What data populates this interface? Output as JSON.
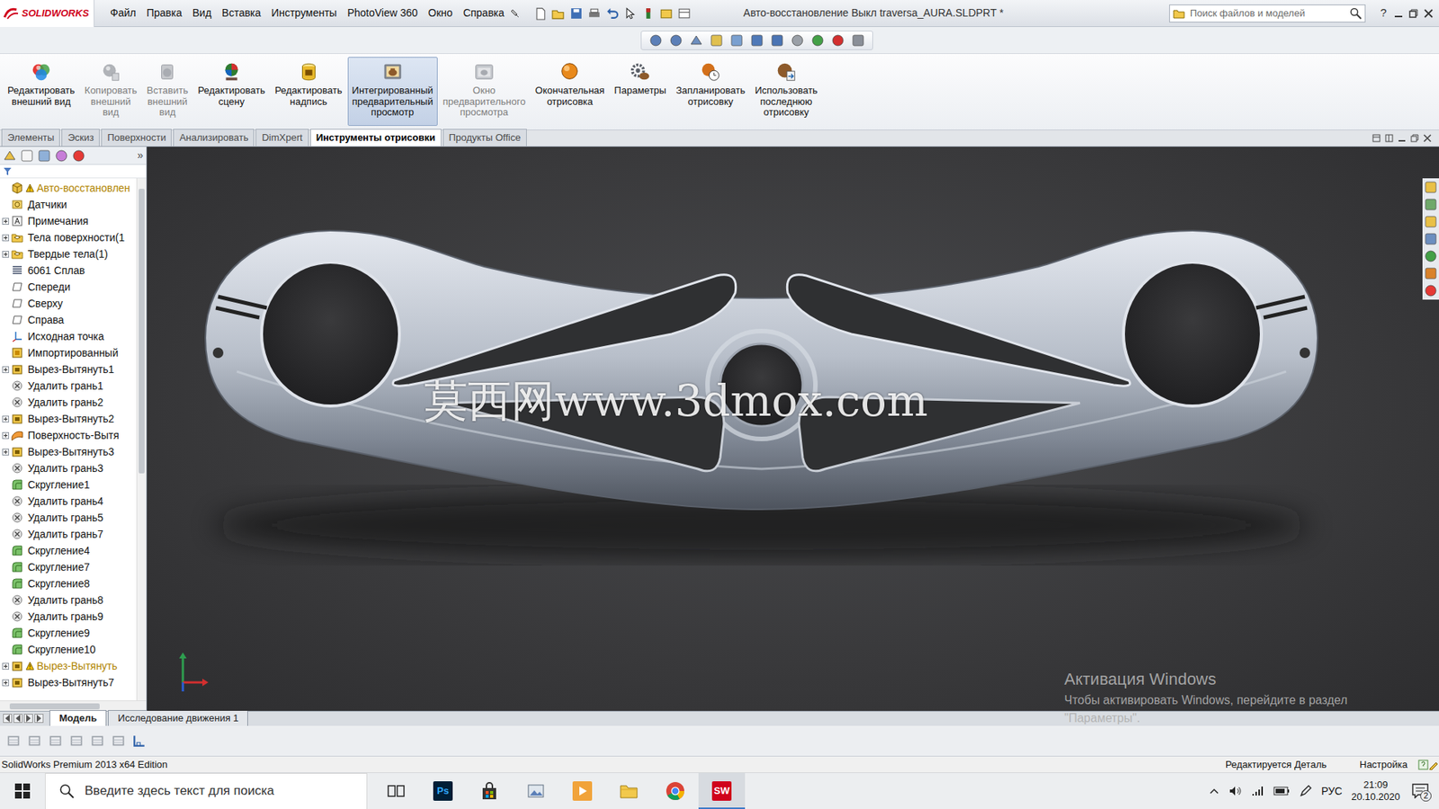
{
  "app": {
    "logo": "SOLIDWORKS",
    "menu": [
      "Файл",
      "Правка",
      "Вид",
      "Вставка",
      "Инструменты",
      "PhotoView 360",
      "Окно",
      "Справка"
    ],
    "title": "Авто-восстановление Выкл traversa_AURA.SLDPRT *",
    "search": {
      "placeholder": "Поиск файлов и моделей"
    },
    "help": "?"
  },
  "ribbon": {
    "buttons": [
      {
        "lines": [
          "Редактировать",
          "внешний вид"
        ],
        "kind": "appearance",
        "disabled": false,
        "selected": false
      },
      {
        "lines": [
          "Копировать",
          "внешний",
          "вид"
        ],
        "kind": "copy",
        "disabled": true,
        "selected": false
      },
      {
        "lines": [
          "Вставить",
          "внешний",
          "вид"
        ],
        "kind": "paste",
        "disabled": true,
        "selected": false
      },
      {
        "lines": [
          "Редактировать",
          "сцену"
        ],
        "kind": "scene",
        "disabled": false,
        "selected": false
      },
      {
        "lines": [
          "Редактировать",
          "надпись"
        ],
        "kind": "decal",
        "disabled": false,
        "selected": false
      },
      {
        "lines": [
          "Интегрированный",
          "предварительный",
          "просмотр"
        ],
        "kind": "preview",
        "disabled": false,
        "selected": true
      },
      {
        "lines": [
          "Окно",
          "предварительного",
          "просмотра"
        ],
        "kind": "previewwindow",
        "disabled": true,
        "selected": false
      },
      {
        "lines": [
          "Окончательная",
          "отрисовка"
        ],
        "kind": "render",
        "disabled": false,
        "selected": false
      },
      {
        "lines": [
          "Параметры"
        ],
        "kind": "options",
        "disabled": false,
        "selected": false
      },
      {
        "lines": [
          "Запланировать",
          "отрисовку"
        ],
        "kind": "schedule",
        "disabled": false,
        "selected": false
      },
      {
        "lines": [
          "Использовать",
          "последнюю",
          "отрисовку"
        ],
        "kind": "last",
        "disabled": false,
        "selected": false
      }
    ]
  },
  "tabs": [
    {
      "label": "Элементы",
      "selected": false
    },
    {
      "label": "Эскиз",
      "selected": false
    },
    {
      "label": "Поверхности",
      "selected": false
    },
    {
      "label": "Анализировать",
      "selected": false
    },
    {
      "label": "DimXpert",
      "selected": false
    },
    {
      "label": "Инструменты отрисовки",
      "selected": true
    },
    {
      "label": "Продукты Office",
      "selected": false
    }
  ],
  "tree": {
    "more": "»",
    "items": [
      {
        "label": "Авто-восстановлен",
        "kind": "root",
        "expandable": false,
        "warning": true
      },
      {
        "label": "Датчики",
        "kind": "sensors",
        "expandable": false,
        "warning": false
      },
      {
        "label": "Примечания",
        "kind": "notes",
        "expandable": true,
        "warning": false
      },
      {
        "label": "Тела поверхности(1",
        "kind": "folder",
        "expandable": true,
        "warning": false
      },
      {
        "label": "Твердые тела(1)",
        "kind": "folder",
        "expandable": true,
        "warning": false
      },
      {
        "label": "6061 Сплав",
        "kind": "material",
        "expandable": false,
        "warning": false
      },
      {
        "label": "Спереди",
        "kind": "plane",
        "expandable": false,
        "warning": false
      },
      {
        "label": "Сверху",
        "kind": "plane",
        "expandable": false,
        "warning": false
      },
      {
        "label": "Справа",
        "kind": "plane",
        "expandable": false,
        "warning": false
      },
      {
        "label": "Исходная точка",
        "kind": "origin",
        "expandable": false,
        "warning": false
      },
      {
        "label": "Импортированный",
        "kind": "imported",
        "expandable": false,
        "warning": false
      },
      {
        "label": "Вырез-Вытянуть1",
        "kind": "extrude",
        "expandable": true,
        "warning": false
      },
      {
        "label": "Удалить грань1",
        "kind": "delete",
        "expandable": false,
        "warning": false
      },
      {
        "label": "Удалить грань2",
        "kind": "delete",
        "expandable": false,
        "warning": false
      },
      {
        "label": "Вырез-Вытянуть2",
        "kind": "extrude",
        "expandable": true,
        "warning": false
      },
      {
        "label": "Поверхность-Вытя",
        "kind": "surface",
        "expandable": true,
        "warning": false
      },
      {
        "label": "Вырез-Вытянуть3",
        "kind": "extrude",
        "expandable": true,
        "warning": false
      },
      {
        "label": "Удалить грань3",
        "kind": "delete",
        "expandable": false,
        "warning": false
      },
      {
        "label": "Скругление1",
        "kind": "fillet",
        "expandable": false,
        "warning": false
      },
      {
        "label": "Удалить грань4",
        "kind": "delete",
        "expandable": false,
        "warning": false
      },
      {
        "label": "Удалить грань5",
        "kind": "delete",
        "expandable": false,
        "warning": false
      },
      {
        "label": "Удалить грань7",
        "kind": "delete",
        "expandable": false,
        "warning": false
      },
      {
        "label": "Скругление4",
        "kind": "fillet",
        "expandable": false,
        "warning": false
      },
      {
        "label": "Скругление7",
        "kind": "fillet",
        "expandable": false,
        "warning": false
      },
      {
        "label": "Скругление8",
        "kind": "fillet",
        "expandable": false,
        "warning": false
      },
      {
        "label": "Удалить грань8",
        "kind": "delete",
        "expandable": false,
        "warning": false
      },
      {
        "label": "Удалить грань9",
        "kind": "delete",
        "expandable": false,
        "warning": false
      },
      {
        "label": "Скругление9",
        "kind": "fillet",
        "expandable": false,
        "warning": false
      },
      {
        "label": "Скругление10",
        "kind": "fillet",
        "expandable": false,
        "warning": false
      },
      {
        "label": "Вырез-Вытянуть",
        "kind": "extrude",
        "expandable": true,
        "warning": true
      },
      {
        "label": "Вырез-Вытянуть7",
        "kind": "extrude",
        "expandable": true,
        "warning": false
      }
    ]
  },
  "viewport": {
    "watermark": "莫西网www.3dmox.com"
  },
  "activation": {
    "title": "Активация Windows",
    "lines": [
      "Чтобы активировать Windows, перейдите в раздел",
      "\"Параметры\"."
    ]
  },
  "bottom_tabs": [
    {
      "label": "Модель",
      "selected": true
    },
    {
      "label": "Исследование движения 1",
      "selected": false
    }
  ],
  "status_bar": {
    "edition": "SolidWorks Premium 2013 x64 Edition",
    "mode": "Редактируется Деталь",
    "setting": "Настройка"
  },
  "taskbar": {
    "search": {
      "placeholder": "Введите здесь текст для поиска"
    },
    "apps": [
      {
        "kind": "taskview",
        "label": "",
        "selected": false
      },
      {
        "kind": "photoshop",
        "label": "Ps",
        "selected": false
      },
      {
        "kind": "store",
        "label": "",
        "selected": false
      },
      {
        "kind": "photos",
        "label": "",
        "selected": false
      },
      {
        "kind": "media",
        "label": "",
        "selected": false
      },
      {
        "kind": "folder",
        "label": "",
        "selected": false
      },
      {
        "kind": "chrome",
        "label": "",
        "selected": false
      },
      {
        "kind": "solidworks",
        "label": "SW",
        "selected": true
      }
    ],
    "language": "РУС",
    "time": "21:09",
    "date": "20.10.2020",
    "notifications": "2"
  }
}
